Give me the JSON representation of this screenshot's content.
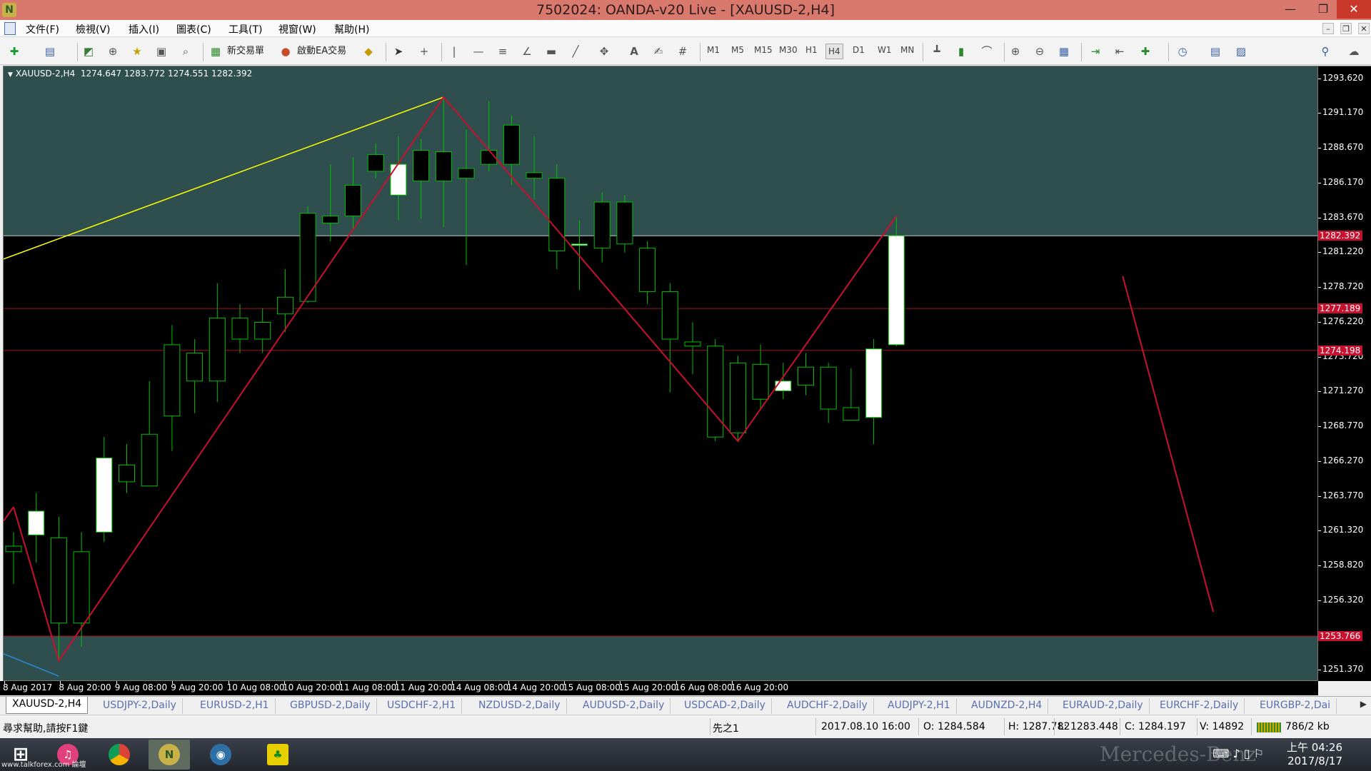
{
  "window": {
    "title": "7502024: OANDA-v20 Live - [XAUUSD-2,H4]",
    "app_icon": "N"
  },
  "menu": {
    "items": [
      "文件(F)",
      "檢視(V)",
      "插入(I)",
      "圖表(C)",
      "工具(T)",
      "視窗(W)",
      "幫助(H)"
    ]
  },
  "toolbar": {
    "new_order_label": "新交易單",
    "ea_label": "啟動EA交易",
    "timeframes": [
      "M1",
      "M5",
      "M15",
      "M30",
      "H1",
      "H4",
      "D1",
      "W1",
      "MN"
    ],
    "active_timeframe": "H4"
  },
  "chart": {
    "info_line": "XAUUSD-2,H4  1274.647 1283.772 1274.551 1282.392",
    "price_labels": [
      "1293.620",
      "1291.170",
      "1288.670",
      "1286.170",
      "1283.670",
      "1281.220",
      "1278.720",
      "1276.220",
      "1273.720",
      "1271.270",
      "1268.770",
      "1266.270",
      "1263.770",
      "1261.320",
      "1258.820",
      "1256.320",
      "1251.370"
    ],
    "badges": [
      "1282.392",
      "1277.189",
      "1274.198",
      "1253.766"
    ],
    "time_labels": [
      "8 Aug 2017",
      "8 Aug 20:00",
      "9 Aug 08:00",
      "9 Aug 20:00",
      "10 Aug 08:00",
      "10 Aug 20:00",
      "11 Aug 08:00",
      "11 Aug 20:00",
      "14 Aug 08:00",
      "14 Aug 20:00",
      "15 Aug 08:00",
      "15 Aug 20:00",
      "16 Aug 08:00",
      "16 Aug 20:00"
    ],
    "colors": {
      "background": "#000000",
      "zone_fill": "#2f4f4f",
      "bull_body": "#ffffff",
      "bear_body": "#000000",
      "wick": "#00c000",
      "zigzag": "#c8102e",
      "trendline": "#ffff00",
      "hline": "#a0101e"
    }
  },
  "chart_data": {
    "type": "candlestick",
    "title": "XAUUSD-2,H4",
    "ylim": [
      1250.5,
      1294.5
    ],
    "candles": [
      {
        "o": 1260.2,
        "h": 1261.2,
        "l": 1257.5,
        "c": 1259.8
      },
      {
        "o": 1261.0,
        "h": 1264.0,
        "l": 1259.0,
        "c": 1262.7
      },
      {
        "o": 1260.8,
        "h": 1262.3,
        "l": 1252.0,
        "c": 1254.7
      },
      {
        "o": 1259.8,
        "h": 1261.2,
        "l": 1253.0,
        "c": 1254.7
      },
      {
        "o": 1261.2,
        "h": 1268.0,
        "l": 1260.5,
        "c": 1266.5
      },
      {
        "o": 1266.0,
        "h": 1267.5,
        "l": 1264.0,
        "c": 1264.8
      },
      {
        "o": 1268.2,
        "h": 1272.0,
        "l": 1264.5,
        "c": 1264.5
      },
      {
        "o": 1274.6,
        "h": 1276.0,
        "l": 1267.0,
        "c": 1269.5
      },
      {
        "o": 1274.0,
        "h": 1275.0,
        "l": 1269.7,
        "c": 1272.0
      },
      {
        "o": 1276.5,
        "h": 1279.0,
        "l": 1270.5,
        "c": 1272.0
      },
      {
        "o": 1276.5,
        "h": 1277.5,
        "l": 1274.0,
        "c": 1275.0
      },
      {
        "o": 1276.2,
        "h": 1277.2,
        "l": 1274.0,
        "c": 1275.0
      },
      {
        "o": 1278.0,
        "h": 1280.0,
        "l": 1275.5,
        "c": 1276.8
      },
      {
        "o": 1284.0,
        "h": 1284.5,
        "l": 1277.6,
        "c": 1277.7
      },
      {
        "o": 1283.8,
        "h": 1287.5,
        "l": 1282.0,
        "c": 1283.3
      },
      {
        "o": 1286.0,
        "h": 1288.0,
        "l": 1282.8,
        "c": 1283.8
      },
      {
        "o": 1288.2,
        "h": 1289.0,
        "l": 1286.5,
        "c": 1287.0
      },
      {
        "o": 1285.3,
        "h": 1289.5,
        "l": 1283.5,
        "c": 1287.5
      },
      {
        "o": 1288.5,
        "h": 1289.3,
        "l": 1283.6,
        "c": 1286.3
      },
      {
        "o": 1288.4,
        "h": 1292.3,
        "l": 1283.0,
        "c": 1286.3
      },
      {
        "o": 1287.2,
        "h": 1290.0,
        "l": 1280.3,
        "c": 1286.5
      },
      {
        "o": 1288.5,
        "h": 1292.0,
        "l": 1287.0,
        "c": 1287.5
      },
      {
        "o": 1290.3,
        "h": 1291.0,
        "l": 1286.0,
        "c": 1287.5
      },
      {
        "o": 1286.9,
        "h": 1289.5,
        "l": 1285.0,
        "c": 1286.5
      },
      {
        "o": 1286.5,
        "h": 1287.5,
        "l": 1280.0,
        "c": 1281.3
      },
      {
        "o": 1281.8,
        "h": 1283.5,
        "l": 1278.5,
        "c": 1281.8
      },
      {
        "o": 1284.8,
        "h": 1285.5,
        "l": 1280.5,
        "c": 1281.5
      },
      {
        "o": 1284.8,
        "h": 1285.3,
        "l": 1281.2,
        "c": 1281.8
      },
      {
        "o": 1281.5,
        "h": 1282.0,
        "l": 1277.5,
        "c": 1278.4
      },
      {
        "o": 1278.4,
        "h": 1279.0,
        "l": 1271.2,
        "c": 1275.0
      },
      {
        "o": 1274.8,
        "h": 1276.2,
        "l": 1272.5,
        "c": 1274.5
      },
      {
        "o": 1274.5,
        "h": 1275.0,
        "l": 1267.7,
        "c": 1268.0
      },
      {
        "o": 1273.3,
        "h": 1273.8,
        "l": 1267.7,
        "c": 1268.3
      },
      {
        "o": 1273.2,
        "h": 1274.6,
        "l": 1270.0,
        "c": 1270.7
      },
      {
        "o": 1271.3,
        "h": 1273.3,
        "l": 1270.7,
        "c": 1272.0
      },
      {
        "o": 1273.0,
        "h": 1274.0,
        "l": 1271.0,
        "c": 1271.7
      },
      {
        "o": 1273.0,
        "h": 1273.3,
        "l": 1269.0,
        "c": 1270.0
      },
      {
        "o": 1270.1,
        "h": 1272.9,
        "l": 1269.2,
        "c": 1269.2
      },
      {
        "o": 1269.4,
        "h": 1275.0,
        "l": 1267.5,
        "c": 1274.3
      },
      {
        "o": 1274.6,
        "h": 1283.8,
        "l": 1274.5,
        "c": 1282.4
      }
    ],
    "zigzag_points": [
      [
        0,
        1263.0
      ],
      [
        2,
        1252.0
      ],
      [
        19,
        1292.3
      ],
      [
        32,
        1267.7
      ],
      [
        39,
        1283.8
      ]
    ],
    "zigzag_extra": [
      [
        49,
        1279.5
      ],
      [
        53,
        1255.5
      ]
    ],
    "trendline": {
      "from": [
        -2,
        1279.8
      ],
      "to": [
        19,
        1292.3
      ]
    },
    "hlines": [
      1282.392,
      1277.189,
      1274.198,
      1253.766
    ],
    "zones": [
      [
        1282.392,
        1294.5
      ],
      [
        1250.5,
        1253.766
      ]
    ]
  },
  "tabs": {
    "items": [
      "XAUUSD-2,H4",
      "USDJPY-2,Daily",
      "EURUSD-2,H1",
      "GBPUSD-2,Daily",
      "USDCHF-2,H1",
      "NZDUSD-2,Daily",
      "AUDUSD-2,Daily",
      "USDCAD-2,Daily",
      "AUDCHF-2,Daily",
      "AUDJPY-2,H1",
      "AUDNZD-2,H4",
      "EURAUD-2,Daily",
      "EURCHF-2,Daily",
      "EURGBP-2,Dai"
    ],
    "active": "XAUUSD-2,H4"
  },
  "status": {
    "help": "尋求幫助,請按F1鍵",
    "profile": "先之1",
    "datetime": "2017.08.10 16:00",
    "open": "O: 1284.584",
    "high": "H: 1287.782",
    "low": "L: 1283.448",
    "close": "C: 1284.197",
    "volume": "V: 14892",
    "traffic": "786/2 kb"
  },
  "taskbar": {
    "time": "上午 04:26",
    "date": "2017/8/17",
    "brand": "Mercedes-Benz",
    "watermark": "www.talkforex.com 論壇"
  }
}
